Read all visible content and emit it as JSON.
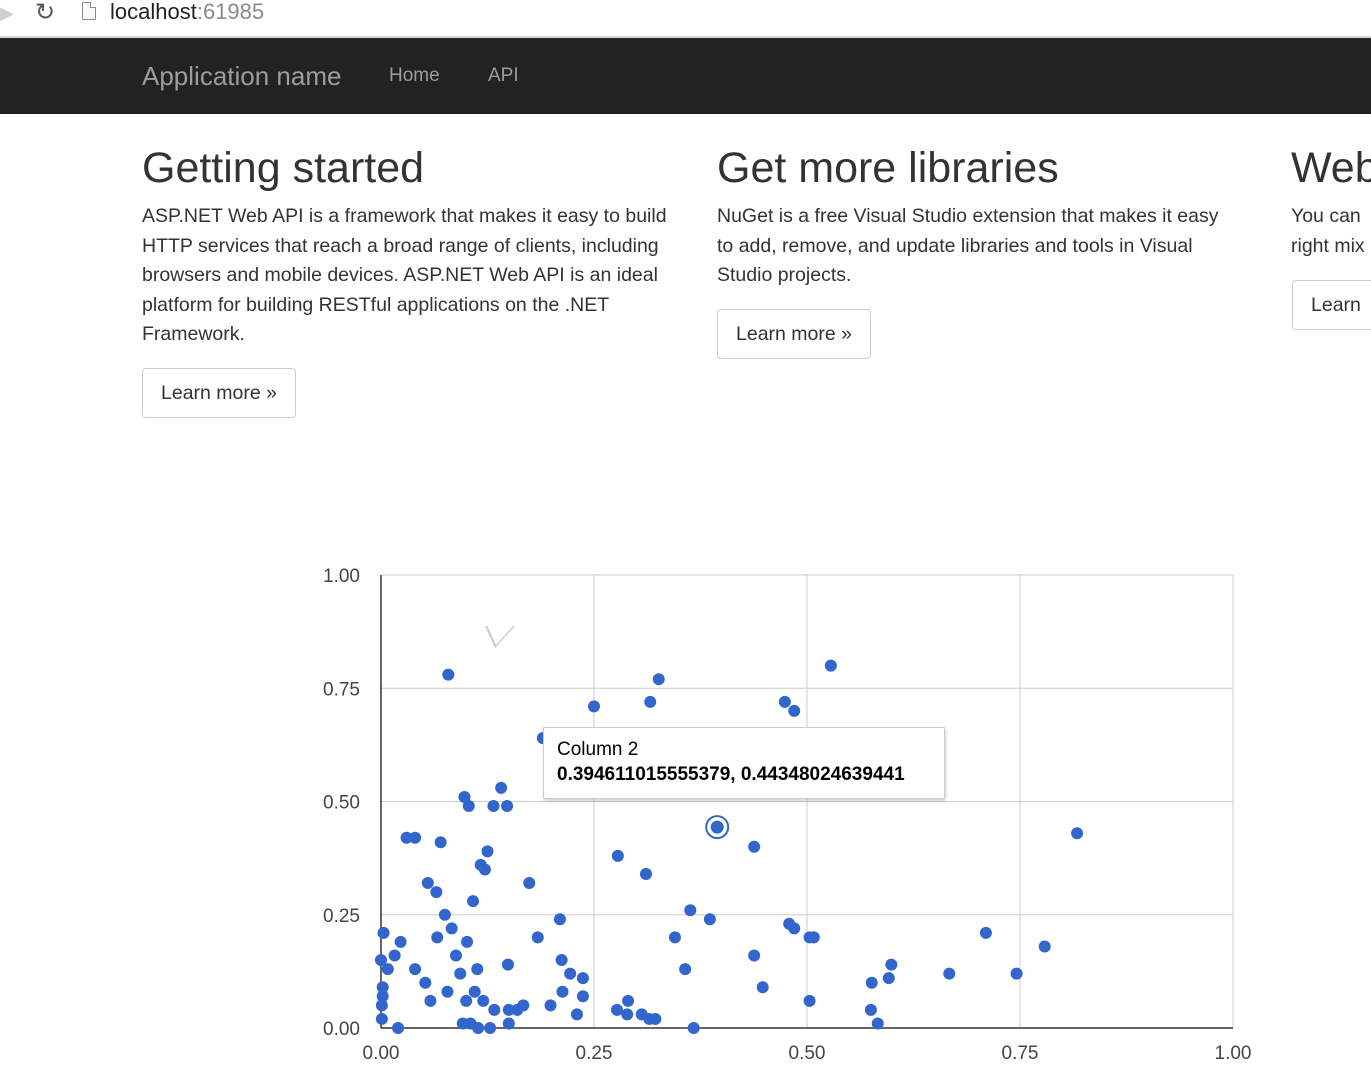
{
  "browser": {
    "address_host": "localhost",
    "address_port": ":61985"
  },
  "navbar": {
    "brand": "Application name",
    "links": [
      "Home",
      "API"
    ]
  },
  "columns": [
    {
      "title": "Getting started",
      "body": "ASP.NET Web API is a framework that makes it easy to build HTTP services that reach a broad range of clients, including browsers and mobile devices. ASP.NET Web API is an ideal platform for building RESTful applications on the .NET Framework.",
      "button": "Learn more »"
    },
    {
      "title": "Get more libraries",
      "body": "NuGet is a free Visual Studio extension that makes it easy to add, remove, and update libraries and tools in Visual Studio projects.",
      "button": "Learn more »"
    },
    {
      "title": "Web",
      "body": "You can right mix",
      "button": "Learn"
    }
  ],
  "colors": {
    "point": "#3366cc",
    "navbar_bg": "#222222",
    "navbar_text": "#9d9d9d",
    "grid": "#cccccc"
  },
  "tooltip": {
    "title": "Column 2",
    "value": "0.394611015555379, 0.44348024639441"
  },
  "chart_data": {
    "type": "scatter",
    "title": "",
    "xlabel": "",
    "ylabel": "",
    "xlim": [
      0,
      1
    ],
    "ylim": [
      0,
      1
    ],
    "x_ticks": [
      "0.00",
      "0.25",
      "0.50",
      "0.75",
      "1.00"
    ],
    "y_ticks": [
      "0.00",
      "0.25",
      "0.50",
      "0.75",
      "1.00"
    ],
    "grid": true,
    "legend": "none",
    "highlighted_point": [
      0.3946,
      0.4435
    ],
    "series": [
      {
        "points": [
          [
            0.079,
            0.78
          ],
          [
            0.25,
            0.71
          ],
          [
            0.326,
            0.77
          ],
          [
            0.316,
            0.72
          ],
          [
            0.474,
            0.72
          ],
          [
            0.485,
            0.7
          ],
          [
            0.528,
            0.8
          ],
          [
            0.19,
            0.64
          ],
          [
            0.098,
            0.51
          ],
          [
            0.103,
            0.49
          ],
          [
            0.141,
            0.53
          ],
          [
            0.132,
            0.49
          ],
          [
            0.148,
            0.49
          ],
          [
            0.03,
            0.42
          ],
          [
            0.04,
            0.42
          ],
          [
            0.07,
            0.41
          ],
          [
            0.125,
            0.39
          ],
          [
            0.117,
            0.36
          ],
          [
            0.122,
            0.35
          ],
          [
            0.055,
            0.32
          ],
          [
            0.065,
            0.3
          ],
          [
            0.174,
            0.32
          ],
          [
            0.108,
            0.28
          ],
          [
            0.278,
            0.38
          ],
          [
            0.311,
            0.34
          ],
          [
            0.438,
            0.4
          ],
          [
            0.395,
            0.44
          ],
          [
            0.817,
            0.43
          ],
          [
            0.003,
            0.21
          ],
          [
            0.023,
            0.19
          ],
          [
            0.016,
            0.16
          ],
          [
            0.008,
            0.13
          ],
          [
            0.0,
            0.15
          ],
          [
            0.04,
            0.13
          ],
          [
            0.052,
            0.1
          ],
          [
            0.066,
            0.2
          ],
          [
            0.075,
            0.25
          ],
          [
            0.083,
            0.22
          ],
          [
            0.101,
            0.19
          ],
          [
            0.088,
            0.16
          ],
          [
            0.093,
            0.12
          ],
          [
            0.113,
            0.13
          ],
          [
            0.002,
            0.09
          ],
          [
            0.002,
            0.07
          ],
          [
            0.001,
            0.05
          ],
          [
            0.001,
            0.02
          ],
          [
            0.02,
            0.0
          ],
          [
            0.058,
            0.06
          ],
          [
            0.078,
            0.08
          ],
          [
            0.1,
            0.06
          ],
          [
            0.11,
            0.08
          ],
          [
            0.12,
            0.06
          ],
          [
            0.096,
            0.01
          ],
          [
            0.105,
            0.01
          ],
          [
            0.114,
            0.0
          ],
          [
            0.128,
            0.0
          ],
          [
            0.133,
            0.04
          ],
          [
            0.15,
            0.04
          ],
          [
            0.16,
            0.04
          ],
          [
            0.167,
            0.05
          ],
          [
            0.15,
            0.01
          ],
          [
            0.149,
            0.14
          ],
          [
            0.184,
            0.2
          ],
          [
            0.21,
            0.24
          ],
          [
            0.212,
            0.15
          ],
          [
            0.222,
            0.12
          ],
          [
            0.237,
            0.11
          ],
          [
            0.213,
            0.08
          ],
          [
            0.199,
            0.05
          ],
          [
            0.23,
            0.03
          ],
          [
            0.237,
            0.07
          ],
          [
            0.277,
            0.04
          ],
          [
            0.29,
            0.06
          ],
          [
            0.289,
            0.03
          ],
          [
            0.306,
            0.03
          ],
          [
            0.315,
            0.02
          ],
          [
            0.322,
            0.02
          ],
          [
            0.367,
            0.0
          ],
          [
            0.345,
            0.2
          ],
          [
            0.363,
            0.26
          ],
          [
            0.386,
            0.24
          ],
          [
            0.357,
            0.13
          ],
          [
            0.438,
            0.16
          ],
          [
            0.448,
            0.09
          ],
          [
            0.479,
            0.23
          ],
          [
            0.485,
            0.22
          ],
          [
            0.503,
            0.2
          ],
          [
            0.508,
            0.2
          ],
          [
            0.503,
            0.06
          ],
          [
            0.576,
            0.1
          ],
          [
            0.575,
            0.04
          ],
          [
            0.583,
            0.01
          ],
          [
            0.599,
            0.14
          ],
          [
            0.596,
            0.11
          ],
          [
            0.667,
            0.12
          ],
          [
            0.71,
            0.21
          ],
          [
            0.746,
            0.12
          ],
          [
            0.779,
            0.18
          ]
        ]
      }
    ]
  }
}
